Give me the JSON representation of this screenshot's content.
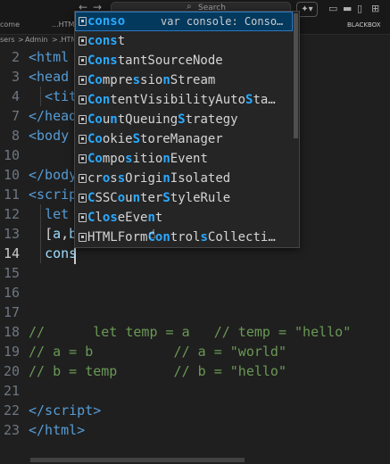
{
  "titlebar": {
    "back_icon": "arrow-left",
    "forward_icon": "arrow-right",
    "search_placeholder": "Search",
    "copilot_icon": "copilot"
  },
  "tabs": {
    "welcome_fragment": "come",
    "html_fragment": "...HTML",
    "right_label": "BLACKBOX"
  },
  "breadcrumb": {
    "path1": "sers",
    "sep1": ">",
    "path2": "Admin",
    "sep2": ">",
    "path3": ".HTML"
  },
  "editor": {
    "lines": [
      {
        "n": "2",
        "html": "<span class=\"tag\">&lt;html</span>"
      },
      {
        "n": "3",
        "html": "<span class=\"tag\">&lt;head</span>"
      },
      {
        "n": "4",
        "html": "  <span class=\"tag\">&lt;tit</span>"
      },
      {
        "n": "7",
        "html": "<span class=\"tag\">&lt;/head</span>"
      },
      {
        "n": "8",
        "html": "<span class=\"tag\">&lt;body</span>"
      },
      {
        "n": "10",
        "html": ""
      },
      {
        "n": "10",
        "html": "<span class=\"tag\">&lt;/body</span>"
      },
      {
        "n": "11",
        "html": "<span class=\"tag\">&lt;scrip</span>"
      },
      {
        "n": "12",
        "html": "  <span class=\"kw\">let</span>"
      },
      {
        "n": "13",
        "html": "  <span>[</span><span class=\"var\">a</span>,<span class=\"var\">b</span>"
      },
      {
        "n": "14",
        "html": "  <span class=\"var\">cons</span>"
      },
      {
        "n": "15",
        "html": ""
      },
      {
        "n": "16",
        "html": ""
      },
      {
        "n": "17",
        "html": ""
      },
      {
        "n": "18",
        "html": "<span class=\"cm\">//      let temp = a   // temp = \"hello\"</span>"
      },
      {
        "n": "19",
        "html": "<span class=\"cm\">// a = b          // a = \"world\"</span>"
      },
      {
        "n": "20",
        "html": "<span class=\"cm\">// b = temp       // b = \"hello\"</span>"
      },
      {
        "n": "21",
        "html": ""
      },
      {
        "n": "22",
        "html": "<span class=\"tag\">&lt;/script&gt;</span>"
      },
      {
        "n": "23",
        "html": "<span class=\"tag\">&lt;/html&gt;</span>"
      }
    ]
  },
  "suggest": {
    "items": [
      {
        "label_parts": [
          [
            "b",
            "conso"
          ],
          [
            "",
            ""
          ]
        ],
        "plain": "conso…",
        "detail": "var console: Conso…",
        "selected": true
      },
      {
        "label_parts": [
          [
            "b",
            "cons"
          ],
          [
            "",
            "t"
          ]
        ],
        "plain": "const",
        "detail": ""
      },
      {
        "label_parts": [
          [
            "b",
            "Cons"
          ],
          [
            "",
            "tantSourceNode"
          ]
        ],
        "plain": "ConstantSourceNode",
        "detail": ""
      },
      {
        "label_parts": [
          [
            "b",
            "Co"
          ],
          [
            "",
            "mpre"
          ],
          [
            "b",
            "s"
          ],
          [
            "",
            "sio"
          ],
          [
            "b",
            "n"
          ],
          [
            "",
            "Stream"
          ]
        ],
        "plain": "CompressionStream",
        "detail": ""
      },
      {
        "label_parts": [
          [
            "b",
            "Con"
          ],
          [
            "",
            "tentVisibilityAuto"
          ],
          [
            "b",
            "S"
          ],
          [
            "",
            "ta…"
          ]
        ],
        "plain": "ContentVisibilityAutoSta…",
        "detail": ""
      },
      {
        "label_parts": [
          [
            "b",
            "Co"
          ],
          [
            "",
            "u"
          ],
          [
            "b",
            "n"
          ],
          [
            "",
            "tQueuing"
          ],
          [
            "b",
            "S"
          ],
          [
            "",
            "trategy"
          ]
        ],
        "plain": "CountQueuingStrategy",
        "detail": ""
      },
      {
        "label_parts": [
          [
            "b",
            "Co"
          ],
          [
            "",
            "okie"
          ],
          [
            "b",
            "S"
          ],
          [
            "",
            "toreManager"
          ]
        ],
        "plain": "CookieStoreManager",
        "detail": ""
      },
      {
        "label_parts": [
          [
            "b",
            "Co"
          ],
          [
            "",
            "mpo"
          ],
          [
            "b",
            "s"
          ],
          [
            "",
            "itio"
          ],
          [
            "b",
            "n"
          ],
          [
            "",
            "Event"
          ]
        ],
        "plain": "CompositionEvent",
        "detail": ""
      },
      {
        "label_parts": [
          [
            "",
            "cr"
          ],
          [
            "b",
            "o"
          ],
          [
            "",
            "s"
          ],
          [
            "b",
            "s"
          ],
          [
            "",
            "Origi"
          ],
          [
            "b",
            "n"
          ],
          [
            "",
            "Isolated"
          ]
        ],
        "plain": "crossOriginIsolated",
        "detail": ""
      },
      {
        "label_parts": [
          [
            "b",
            "C"
          ],
          [
            "",
            "SSC"
          ],
          [
            "b",
            "o"
          ],
          [
            "",
            "u"
          ],
          [
            "b",
            "n"
          ],
          [
            "",
            "ter"
          ],
          [
            "b",
            "S"
          ],
          [
            "",
            "tyleRule"
          ]
        ],
        "plain": "CSSCounterStyleRule",
        "detail": ""
      },
      {
        "label_parts": [
          [
            "b",
            "C"
          ],
          [
            "",
            "l"
          ],
          [
            "b",
            "o"
          ],
          [
            "b",
            "s"
          ],
          [
            "",
            "eEve"
          ],
          [
            "b",
            "n"
          ],
          [
            "",
            "t"
          ]
        ],
        "plain": "CloseEvent",
        "detail": ""
      },
      {
        "label_parts": [
          [
            "",
            "HTMLForm"
          ],
          [
            "b",
            "C"
          ],
          [
            "b",
            "o"
          ],
          [
            "b",
            "n"
          ],
          [
            "",
            "trol"
          ],
          [
            "b",
            "s"
          ],
          [
            "",
            "Collecti…"
          ]
        ],
        "plain": "HTMLFormControlsCollecti…",
        "detail": ""
      }
    ]
  }
}
